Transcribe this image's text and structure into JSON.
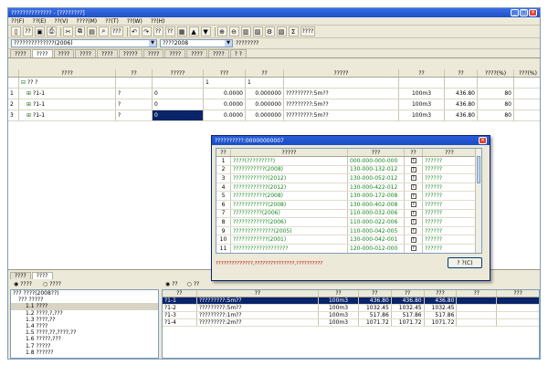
{
  "window": {
    "title": "?????????????? - [????????]"
  },
  "menu": [
    "??(F)",
    "??(E)",
    "??(V)",
    "????(M)",
    "??(T)",
    "??(W)",
    "??(H)"
  ],
  "toolbar": {
    "buttons": [
      "?",
      "??",
      "?",
      "?",
      "?",
      "?",
      "?",
      "?",
      "?",
      "???",
      "?",
      "?",
      "??",
      "??",
      "?",
      "?",
      "?",
      "?",
      "?",
      "?",
      "?",
      "?",
      "?",
      "?",
      "?",
      "????"
    ]
  },
  "combos": {
    "project": "??????????????(2006)",
    "std": "????2008",
    "label": "????????"
  },
  "tabs": [
    "????",
    "????",
    "????",
    "????",
    "????",
    "?????",
    "????",
    "????",
    "????",
    "????",
    "? ?"
  ],
  "grid": {
    "headers": [
      "????",
      "??",
      "?????",
      "???",
      "??",
      "?????",
      "??",
      "??",
      "????(%)",
      "???(%)"
    ],
    "root": {
      "code": "?? ?",
      "qty": "1",
      "amount": "1"
    },
    "rows": [
      {
        "idx": "1",
        "code": "?1-1",
        "type": "?",
        "expr": "0",
        "qty": "0.0000",
        "amount": "0.000000",
        "name": "?????????:5m??",
        "unit": "100m3",
        "price": "436.80",
        "mgmt": "80"
      },
      {
        "idx": "2",
        "code": "?1-1",
        "type": "?",
        "expr": "0",
        "qty": "0.0000",
        "amount": "0.000000",
        "name": "?????????:5m??",
        "unit": "100m3",
        "price": "436.80",
        "mgmt": "80"
      },
      {
        "idx": "3",
        "code": "?1-1",
        "type": "?",
        "expr": "0",
        "qty": "0.0000",
        "amount": "0.000000",
        "name": "?????????:5m??",
        "unit": "100m3",
        "price": "436.80",
        "mgmt": "80"
      }
    ]
  },
  "bottom": {
    "tabs": [
      "????",
      "????"
    ],
    "radios": [
      "????",
      "????"
    ],
    "mode": [
      "??",
      "??"
    ],
    "tree": [
      "??? ????(2008??)",
      "??? ?????",
      "1.1 ????",
      "1.2 ????,?,???",
      "1.3 ????,??",
      "1.4 ????",
      "1.5 ????,??,????,??",
      "1.6 ?????,???",
      "1.7 ?????",
      "1.8 ??????"
    ],
    "headers": [
      "??",
      "??",
      "??",
      "??",
      "??",
      "???",
      "??",
      "???"
    ],
    "rows": [
      {
        "code": "?1-1",
        "name": "?????????:5m??",
        "unit": "100m3",
        "price": "436.80",
        "base": "436.80",
        "labor": "436.80",
        "mat": "",
        "mach": ""
      },
      {
        "code": "?1-2",
        "name": "?????????:5m??",
        "unit": "100m3",
        "price": "1032.45",
        "base": "1032.45",
        "labor": "1032.45",
        "mat": "",
        "mach": ""
      },
      {
        "code": "?1-3",
        "name": "?????????:1m??",
        "unit": "100m3",
        "price": "517.86",
        "base": "517.86",
        "labor": "517.86",
        "mat": "",
        "mach": ""
      },
      {
        "code": "?1-4",
        "name": "?????????:2m??",
        "unit": "100m3",
        "price": "1071.72",
        "base": "1071.72",
        "labor": "1071.72",
        "mat": "",
        "mach": ""
      }
    ]
  },
  "dialog": {
    "title": "??????????:00000000007",
    "headers": [
      "??",
      "?????",
      "???",
      "??",
      "???"
    ],
    "rows": [
      {
        "n": "1",
        "name": "????(?????????)",
        "code": "000-000-000-000",
        "chk": "?",
        "note": "??????"
      },
      {
        "n": "2",
        "name": "???????????(2008)",
        "code": "130-000-132-012",
        "chk": "?",
        "note": "??????"
      },
      {
        "n": "3",
        "name": "????????????(2012)",
        "code": "130-000-052-012",
        "chk": "?",
        "note": "??????"
      },
      {
        "n": "4",
        "name": "????????????(2012)",
        "code": "130-000-422-012",
        "chk": "?",
        "note": "??????"
      },
      {
        "n": "5",
        "name": "???????????(2008)",
        "code": "130-000-172-008",
        "chk": "?",
        "note": "??????"
      },
      {
        "n": "6",
        "name": "????????????(2008)",
        "code": "130-000-402-008",
        "chk": "?",
        "note": "??????"
      },
      {
        "n": "7",
        "name": "??????????(2006)",
        "code": "110-000-032-006",
        "chk": "?",
        "note": "??????"
      },
      {
        "n": "8",
        "name": "????????????(2006)",
        "code": "110-000-022-006",
        "chk": "?",
        "note": "??????"
      },
      {
        "n": "9",
        "name": "??????????????(2005)",
        "code": "110-000-042-005",
        "chk": "?",
        "note": "??????"
      },
      {
        "n": "10",
        "name": "????????????(2001)",
        "code": "130-000-042-001",
        "chk": "?",
        "note": "??????"
      },
      {
        "n": "11",
        "name": "???????????????????",
        "code": "120-000-012-000",
        "chk": "?",
        "note": "??????"
      }
    ],
    "note": "??????????????,???????????????,??????????",
    "close": "? ?(C)"
  },
  "colors": {
    "titlebar": "#2058d6",
    "link": "#13861f",
    "warn": "#c00000"
  }
}
